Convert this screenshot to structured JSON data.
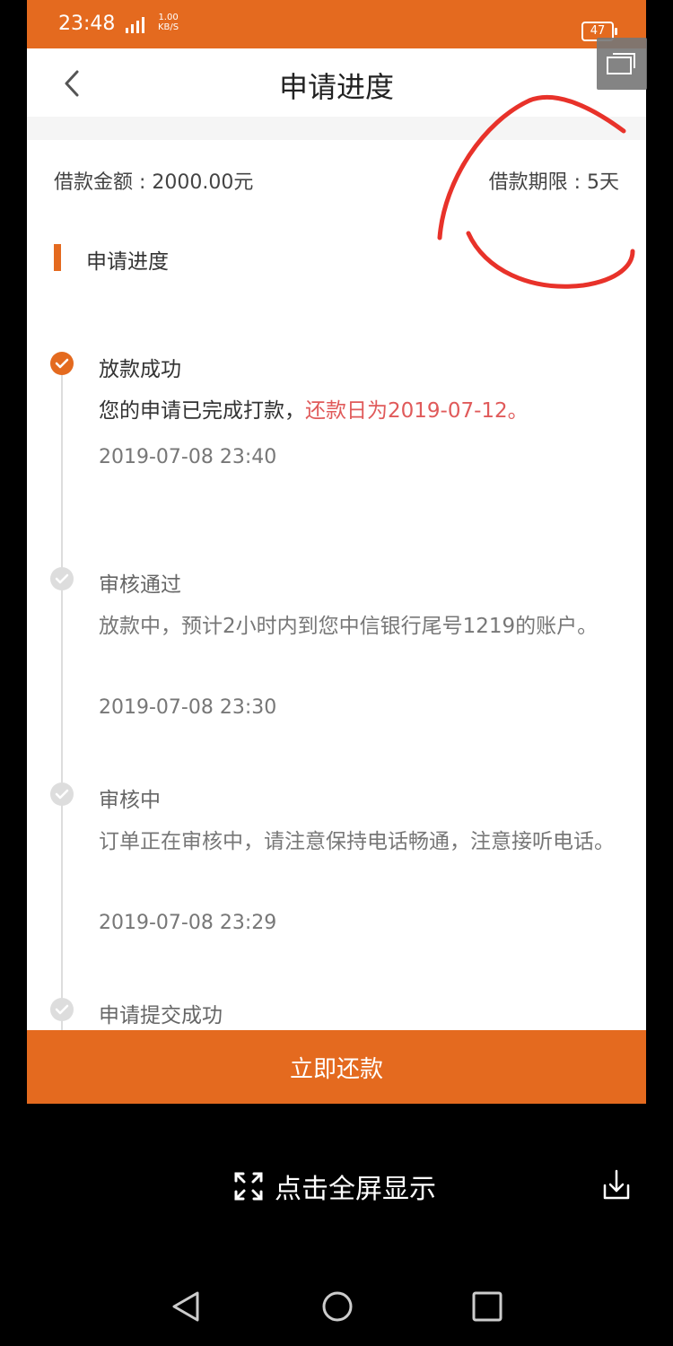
{
  "status_bar": {
    "time": "23:48",
    "signal": "4G",
    "speed_value": "1.00",
    "speed_unit": "KB/S",
    "battery": "47"
  },
  "header": {
    "title": "申请进度"
  },
  "loan": {
    "amount_label": "借款金额 : 2000.00元",
    "term_label": "借款期限 : 5天"
  },
  "section": {
    "title": "申请进度"
  },
  "steps": [
    {
      "title": "放款成功",
      "desc_plain": "您的申请已完成打款，",
      "desc_highlight": "还款日为2019-07-12。",
      "time": "2019-07-08 23:40"
    },
    {
      "title": "审核通过",
      "desc": "放款中，预计2小时内到您中信银行尾号1219的账户。",
      "time": "2019-07-08 23:30"
    },
    {
      "title": "审核中",
      "desc": "订单正在审核中，请注意保持电话畅通，注意接听电话。",
      "time": "2019-07-08 23:29"
    },
    {
      "title": "申请提交成功"
    }
  ],
  "actions": {
    "repay_label": "立即还款"
  },
  "viewer": {
    "fullscreen_label": "点击全屏显示"
  },
  "colors": {
    "accent": "#e46a1f",
    "highlight": "#e05a5a",
    "annotation": "#e8322a"
  }
}
